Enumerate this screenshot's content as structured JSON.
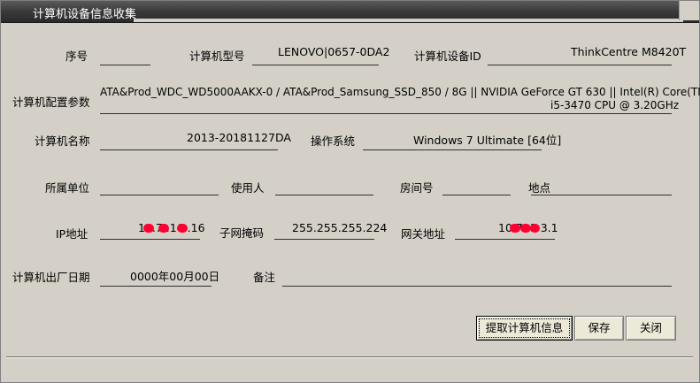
{
  "window": {
    "title": "计算机设备信息收集"
  },
  "form": {
    "serial_label": "序号",
    "serial_value": "",
    "model_label": "计算机型号",
    "model_value": "LENOVO|0657-0DA2",
    "device_id_label": "计算机设备ID",
    "device_id_value": "ThinkCentre M8420T",
    "config_label": "计算机配置参数",
    "config_line1": "ATA&Prod_WDC_WD5000AAKX-0 / ATA&Prod_Samsung_SSD_850 / 8G || NVIDIA GeForce GT 630   || Intel(R) Core(TM)",
    "config_line2": "i5-3470 CPU @ 3.20GHz",
    "name_label": "计算机名称",
    "name_value": "2013-20181127DA",
    "os_label": "操作系统",
    "os_value": "Windows 7 Ultimate [64位]",
    "dept_label": "所属单位",
    "dept_value": "",
    "user_label": "使用人",
    "user_value": "",
    "room_label": "房间号",
    "room_value": "",
    "location_label": "地点",
    "location_value": "",
    "ip_label": "IP地址",
    "ip_value": "10.7  .16  .16",
    "mask_label": "子网掩码",
    "mask_value": "255.255.255.224",
    "gateway_label": "网关地址",
    "gateway_value": "10.7  .1  3.1",
    "date_label": "计算机出厂日期",
    "date_value": "0000年00月00日",
    "note_label": "备注",
    "note_value": ""
  },
  "buttons": {
    "fetch": "提取计算机信息",
    "save": "保存",
    "close": "关闭"
  },
  "colors": {
    "titlebar": "#3a3a3a",
    "background": "#d4d0c8",
    "redaction": "#ff0033"
  }
}
